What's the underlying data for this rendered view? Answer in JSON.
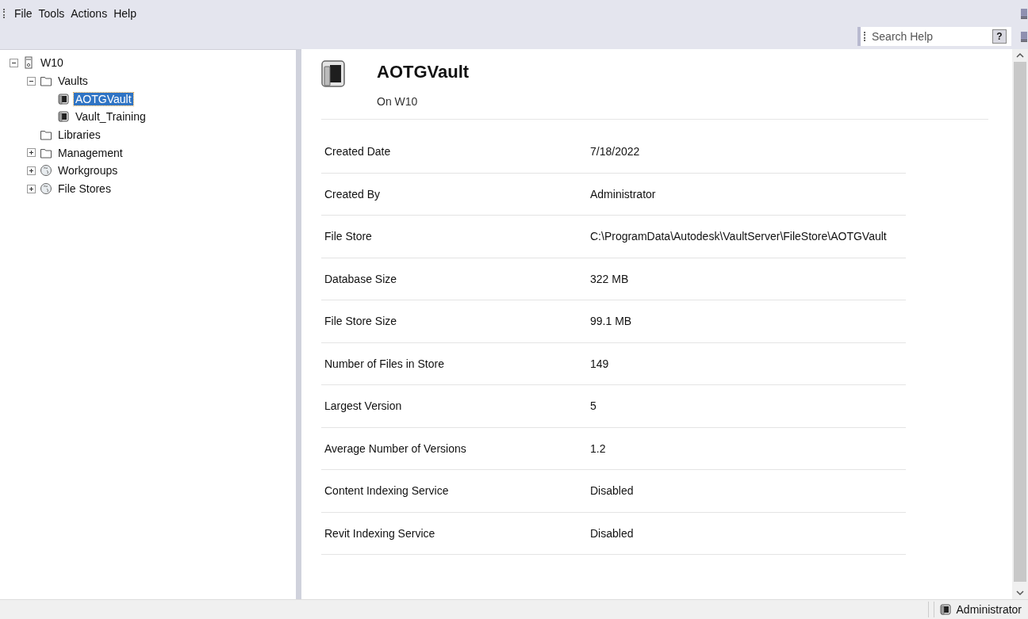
{
  "menu": [
    "File",
    "Tools",
    "Actions",
    "Help"
  ],
  "search": {
    "placeholder": "Search Help",
    "help": "?"
  },
  "tree": [
    {
      "label": "W10",
      "kind": "server",
      "expanded": true,
      "selected": false,
      "children": [
        {
          "label": "Vaults",
          "kind": "folder",
          "expanded": true,
          "selected": false,
          "children": [
            {
              "label": "AOTGVault",
              "kind": "vault",
              "selected": true
            },
            {
              "label": "Vault_Training",
              "kind": "vault",
              "selected": false
            }
          ]
        },
        {
          "label": "Libraries",
          "kind": "folder",
          "selected": false
        },
        {
          "label": "Management",
          "kind": "folder",
          "expanded": false,
          "selected": false
        },
        {
          "label": "Workgroups",
          "kind": "globe",
          "expanded": false,
          "selected": false
        },
        {
          "label": "File Stores",
          "kind": "globe",
          "expanded": false,
          "selected": false
        }
      ]
    }
  ],
  "detail": {
    "title": "AOTGVault",
    "subtitle": "On W10",
    "properties": [
      {
        "label": "Created Date",
        "value": "7/18/2022"
      },
      {
        "label": "Created By",
        "value": "Administrator"
      },
      {
        "label": "File Store",
        "value": "C:\\ProgramData\\Autodesk\\VaultServer\\FileStore\\AOTGVault"
      },
      {
        "label": "Database Size",
        "value": "322 MB"
      },
      {
        "label": "File Store Size",
        "value": "99.1 MB"
      },
      {
        "label": "Number of Files in Store",
        "value": "149"
      },
      {
        "label": "Largest Version",
        "value": "5"
      },
      {
        "label": "Average Number of Versions",
        "value": "1.2"
      },
      {
        "label": "Content Indexing Service",
        "value": "Disabled"
      },
      {
        "label": "Revit Indexing Service",
        "value": "Disabled"
      }
    ]
  },
  "status_bar": {
    "user": "Administrator"
  }
}
